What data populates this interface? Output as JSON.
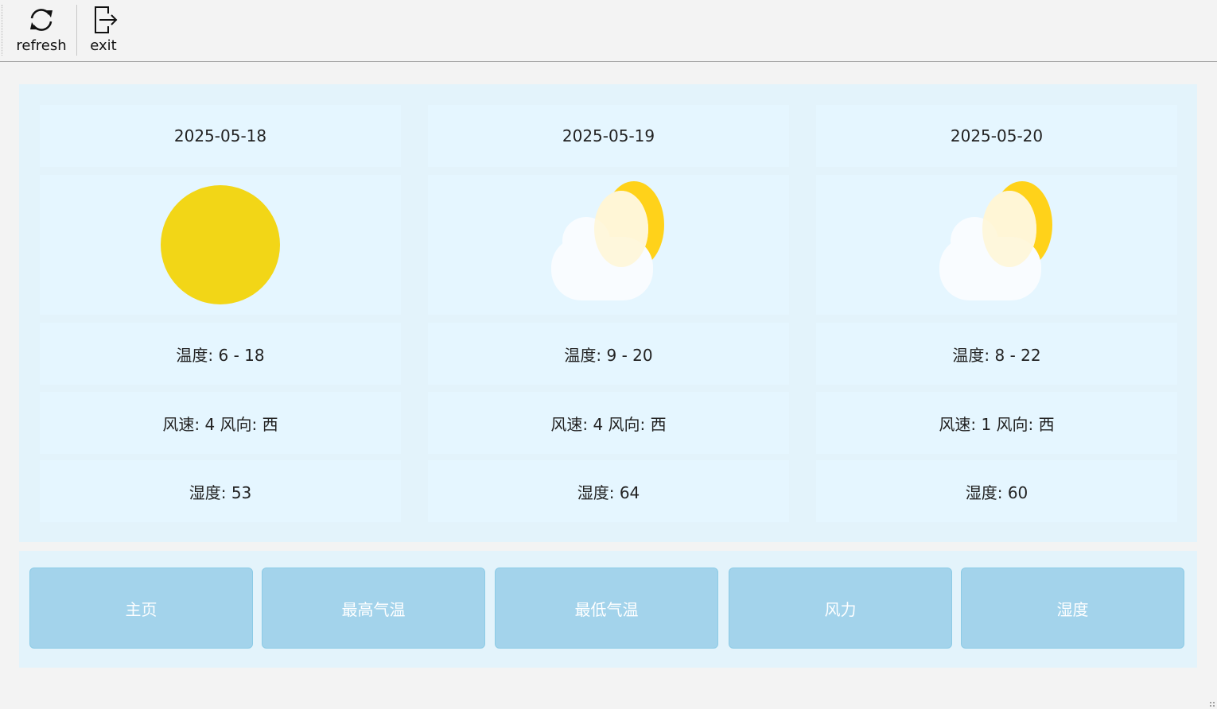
{
  "toolbar": {
    "refresh": {
      "label": "refresh",
      "icon": "refresh-icon"
    },
    "exit": {
      "label": "exit",
      "icon": "exit-icon"
    }
  },
  "forecast": [
    {
      "date": "2025-05-18",
      "icon": "sunny-icon",
      "temp": "温度: 6 - 18",
      "wind": "风速: 4 风向: 西",
      "humidity": "湿度: 53"
    },
    {
      "date": "2025-05-19",
      "icon": "partly-cloudy-icon",
      "temp": "温度: 9 - 20",
      "wind": "风速: 4 风向: 西",
      "humidity": "湿度: 64"
    },
    {
      "date": "2025-05-20",
      "icon": "partly-cloudy-icon",
      "temp": "温度: 8 - 22",
      "wind": "风速: 1 风向: 西",
      "humidity": "湿度: 60"
    }
  ],
  "nav": [
    "主页",
    "最高气温",
    "最低气温",
    "风力",
    "湿度"
  ],
  "colors": {
    "sun": "#f2d617",
    "sun_partial": "#ffd21a",
    "cloud": "#f9fcff",
    "nav_button": "#a3d3eb",
    "panel": "#e3f3fb"
  }
}
